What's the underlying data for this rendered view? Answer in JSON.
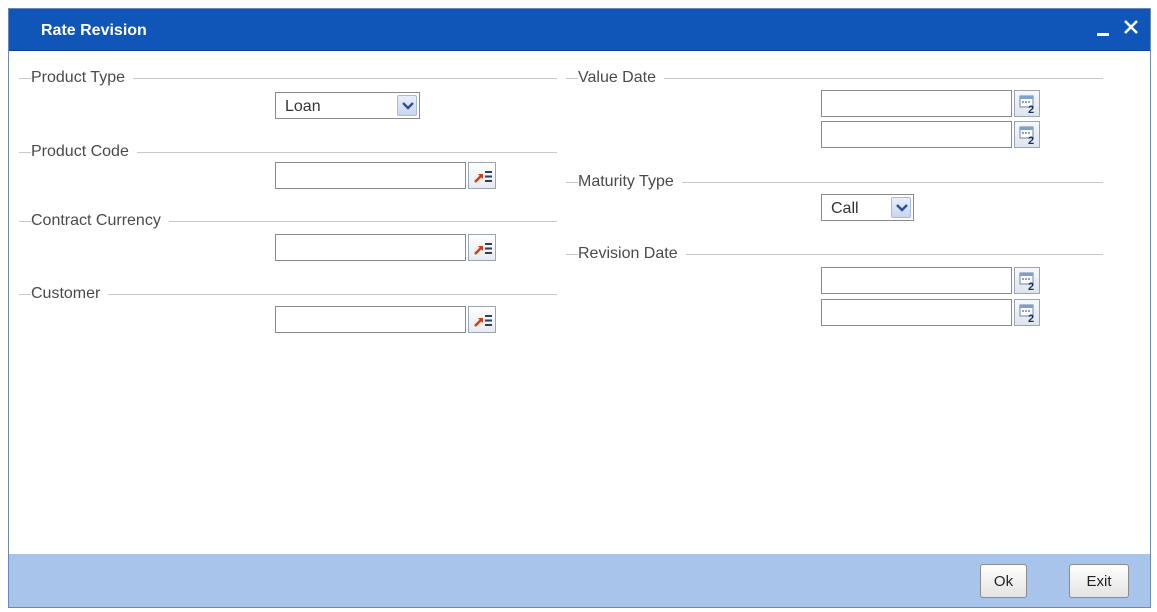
{
  "window": {
    "title": "Rate Revision"
  },
  "left": {
    "product_type": {
      "legend": "Product Type",
      "selected": "Loan"
    },
    "product_code": {
      "legend": "Product Code",
      "value": ""
    },
    "contract_currency": {
      "legend": "Contract Currency",
      "value": ""
    },
    "customer": {
      "legend": "Customer",
      "value": ""
    }
  },
  "right": {
    "value_date": {
      "legend": "Value Date",
      "from": "",
      "to": ""
    },
    "maturity_type": {
      "legend": "Maturity Type",
      "selected": "Call"
    },
    "revision_date": {
      "legend": "Revision Date",
      "from": "",
      "to": ""
    }
  },
  "footer": {
    "ok_label": "Ok",
    "exit_label": "Exit"
  },
  "colors": {
    "titlebar": "#0f56b8",
    "footer": "#a8c4ea"
  },
  "icons": {
    "lov": "list-of-values-icon",
    "calendar": "calendar-icon",
    "minimize": "minimize-icon",
    "close": "close-icon"
  }
}
